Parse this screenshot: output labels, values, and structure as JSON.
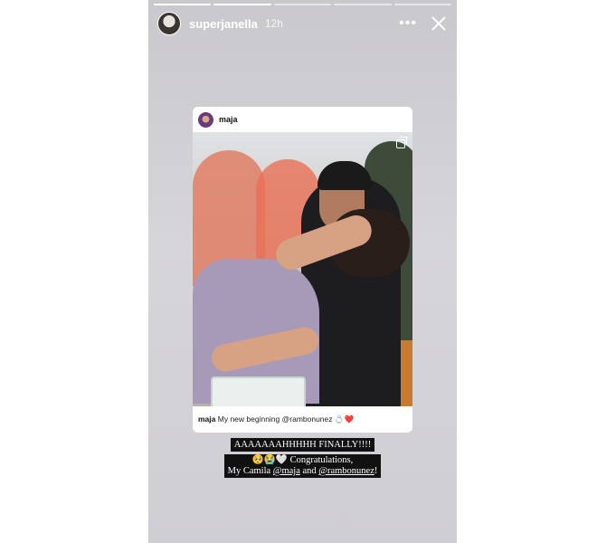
{
  "story": {
    "progress_segments": 5,
    "progress_done": 2,
    "username": "superjanella",
    "timestamp": "12h",
    "more_glyph": "•••",
    "close_icon": "x-icon"
  },
  "shared_post": {
    "author": "maja",
    "caption_user": "maja",
    "caption_text": "My new beginning @rambonunez 💍❤️",
    "carousel_icon": "multiple-images-icon"
  },
  "overlay_text": {
    "line1": "AAAAAAAHHHHH FINALLY!!!!",
    "line2": "🥺😭🤍 Congratulations,",
    "line3_prefix": "My Camila ",
    "mention1": "@maja",
    "line3_mid": " and ",
    "mention2": "@rambonunez",
    "line3_suffix": "!"
  }
}
